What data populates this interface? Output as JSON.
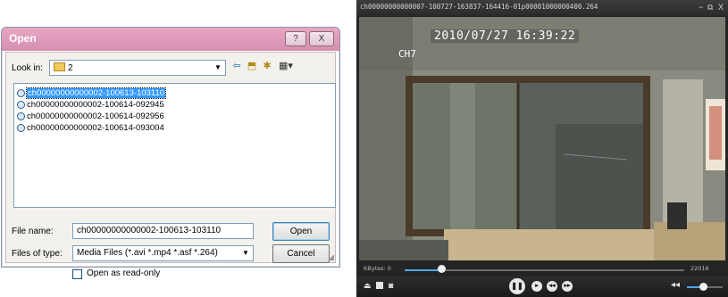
{
  "dialog": {
    "title": "Open",
    "help_glyph": "?",
    "close_glyph": "X",
    "look_in_label": "Look in:",
    "look_in_value": "2",
    "files": [
      "ch00000000000002-100613-103110",
      "ch00000000000002-100614-092945",
      "ch00000000000002-100614-092956",
      "ch00000000000002-100614-093004"
    ],
    "selected_index": 0,
    "file_name_label": "File name:",
    "file_name_value": "ch00000000000002-100613-103110",
    "file_type_label": "Files of type:",
    "file_type_value": "Media Files (*.avi *.mp4 *.asf *.264)",
    "open_button": "Open",
    "cancel_button": "Cancel",
    "readonly_label": "Open as read-only",
    "readonly_checked": false
  },
  "player": {
    "title": "ch00000000000007-100727-163837-164416-01p00001000000400.264",
    "title_controls": [
      "−",
      "⧉",
      "X"
    ],
    "osd_datetime": "2010/07/27 16:39:22",
    "osd_channel": "CH7",
    "seek_label": "KBytes: 0",
    "seek_end": "22016",
    "progress": 0.13,
    "volume": 0.45,
    "accent": "#4aa7e8"
  }
}
